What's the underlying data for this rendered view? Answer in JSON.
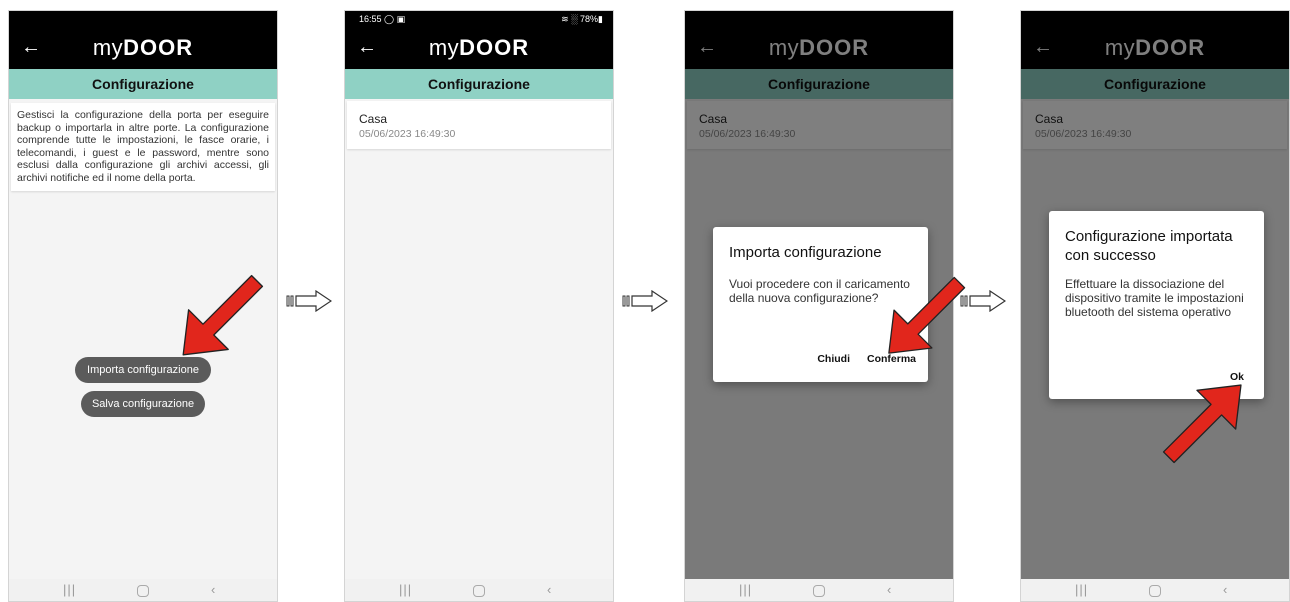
{
  "app": {
    "logo_my": "my",
    "logo_door": "DOOR",
    "screen_title": "Configurazione",
    "back_icon": "back-arrow-icon"
  },
  "status_bar": {
    "time": "16:55 ◯ ▣",
    "right": "≋ ░ 78%▮"
  },
  "screen1": {
    "description": "Gestisci la configurazione della porta per eseguire backup o importarla in altre porte. La configurazione comprende tutte le impostazioni, le fasce orarie, i telecomandi, i guest e le password, mentre sono esclusi dalla configurazione gli archivi accessi, gli archivi notifiche ed il nome della porta.",
    "import_button": "Importa configurazione",
    "save_button": "Salva configurazione"
  },
  "config_item": {
    "name": "Casa",
    "date": "05/06/2023 16:49:30"
  },
  "dialog_import": {
    "title": "Importa configurazione",
    "message": "Vuoi procedere con il caricamento della nuova configurazione?",
    "cancel": "Chiudi",
    "confirm": "Conferma"
  },
  "dialog_success": {
    "title": "Configurazione importata con successo",
    "message": "Effettuare la dissociazione del dispositivo tramite le impostazioni bluetooth del sistema operativo",
    "ok": "Ok"
  },
  "nav_bar": {
    "recent": "|||",
    "back": "‹"
  },
  "colors": {
    "title_bar": "#8fd1c4",
    "top_bar": "#000000",
    "pill_button": "#5b5b5b",
    "annotation_arrow": "#e1261c"
  }
}
